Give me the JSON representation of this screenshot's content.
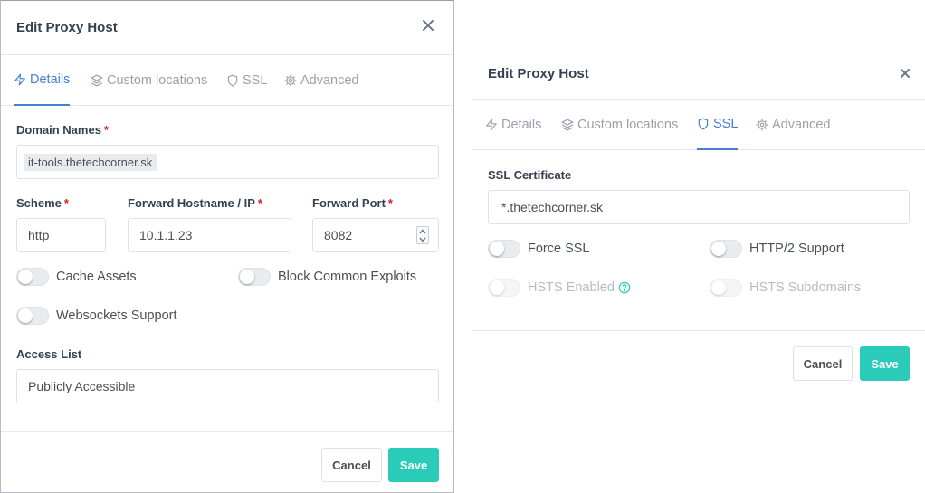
{
  "left_modal": {
    "title": "Edit Proxy Host",
    "tabs": [
      {
        "label": "Details",
        "icon": "lightning-icon",
        "active": true
      },
      {
        "label": "Custom locations",
        "icon": "layers-icon",
        "active": false
      },
      {
        "label": "SSL",
        "icon": "shield-icon",
        "active": false
      },
      {
        "label": "Advanced",
        "icon": "gear-icon",
        "active": false
      }
    ],
    "domain_names": {
      "label": "Domain Names",
      "required": "*",
      "chip": "it-tools.thetechcorner.sk"
    },
    "scheme": {
      "label": "Scheme",
      "required": "*",
      "value": "http"
    },
    "forward_host": {
      "label": "Forward Hostname / IP",
      "required": "*",
      "value": "10.1.1.23"
    },
    "forward_port": {
      "label": "Forward Port",
      "required": "*",
      "value": "8082"
    },
    "toggles": {
      "cache_assets": {
        "label": "Cache Assets",
        "on": false
      },
      "block_exploits": {
        "label": "Block Common Exploits",
        "on": false
      },
      "websockets": {
        "label": "Websockets Support",
        "on": false
      }
    },
    "access_list": {
      "label": "Access List",
      "value": "Publicly Accessible"
    },
    "cancel_label": "Cancel",
    "save_label": "Save"
  },
  "right_modal": {
    "title": "Edit Proxy Host",
    "tabs": [
      {
        "label": "Details",
        "icon": "lightning-icon",
        "active": false
      },
      {
        "label": "Custom locations",
        "icon": "layers-icon",
        "active": false
      },
      {
        "label": "SSL",
        "icon": "shield-icon",
        "active": true
      },
      {
        "label": "Advanced",
        "icon": "gear-icon",
        "active": false
      }
    ],
    "ssl_certificate": {
      "label": "SSL Certificate",
      "value": "*.thetechcorner.sk"
    },
    "toggles": {
      "force_ssl": {
        "label": "Force SSL",
        "on": false,
        "disabled": false
      },
      "http2": {
        "label": "HTTP/2 Support",
        "on": false,
        "disabled": false
      },
      "hsts": {
        "label": "HSTS Enabled",
        "on": false,
        "disabled": true
      },
      "hsts_subdomains": {
        "label": "HSTS Subdomains",
        "on": false,
        "disabled": true
      }
    },
    "cancel_label": "Cancel",
    "save_label": "Save"
  },
  "colors": {
    "accent": "#467fcf",
    "save": "#2bcbba",
    "required": "#cd201f",
    "help": "#2bcbba"
  }
}
